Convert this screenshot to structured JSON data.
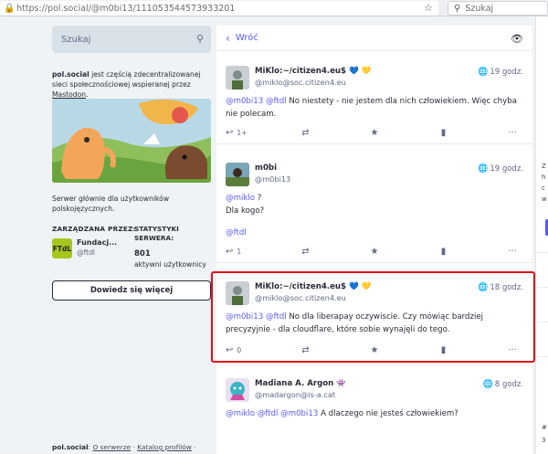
{
  "browser": {
    "url_domain": "https://pol.social",
    "url_path": "/@m0bi13/111053544573933201",
    "search_placeholder": "Szukaj"
  },
  "sidebar": {
    "search_placeholder": "Szukaj",
    "about_bold": "pol.social",
    "about_text": " jest częścią zdecentralizowanej sieci społecznościowej wspieranej przez ",
    "about_link": "Mastodon",
    "about_end": ".",
    "description": "Serwer głównie dla użytkowników polskojęzycznych.",
    "admin_label": "ZARZĄDZANA PRZEZ:",
    "admin_avatar_text": "FTdL",
    "admin_name": "Fundacj...",
    "admin_handle": "@ftdl",
    "stats_label": "STATYSTYKI SERWERA:",
    "stats_number": "801",
    "stats_sub": "aktywni użytkownicy",
    "learn_more": "Dowiedz się więcej",
    "footer": {
      "server": "pol.social",
      "sep1": ": ",
      "about": "O serwerze",
      "dot": " · ",
      "profiles": "Katalog profilów",
      "dot2": " ·"
    }
  },
  "column": {
    "back_label": "Wróć"
  },
  "statuses": [
    {
      "name": "MiKlo:~/citizen4.eu$",
      "emoji": "💙 💛",
      "handle": "@miklo@soc.citizen4.eu",
      "time": "19 godz.",
      "mentions": "@m0bi13 @ftdl",
      "text": " No niestety - nie jestem dla nich człowiekiem. Więc chyba nie polecam.",
      "reply_count": "1+"
    },
    {
      "name": "m0bi",
      "handle": "@m0bi13",
      "time": "19 godz.",
      "mention": "@miklo",
      "text_after_mention": " ?",
      "line2": "Dla kogo?",
      "tag": "@ftdl",
      "reply_count": "1"
    },
    {
      "name": "MiKlo:~/citizen4.eu$",
      "emoji": "💙 💛",
      "handle": "@miklo@soc.citizen4.eu",
      "time": "18 godz.",
      "mentions": "@m0bi13 @ftdl",
      "text": " No dla liberapay oczywiscie. Czy mówiąc bardziej precyzyjnie - dla cloudflare, które sobie wynajęli do tego.",
      "reply_count": "0"
    },
    {
      "name": "Madiana A. Argon",
      "emoji": "👾",
      "handle": "@madargon@is-a.cat",
      "time": "8 godz.",
      "mentions": "@miklo @ftdl @m0bi13",
      "text": " A dlaczego nie jesteś człowiekiem?"
    }
  ],
  "right_panel": {
    "z": "Z",
    "h": "h",
    "c": "c",
    "w": "w",
    "hash": "#",
    "num": "3"
  }
}
